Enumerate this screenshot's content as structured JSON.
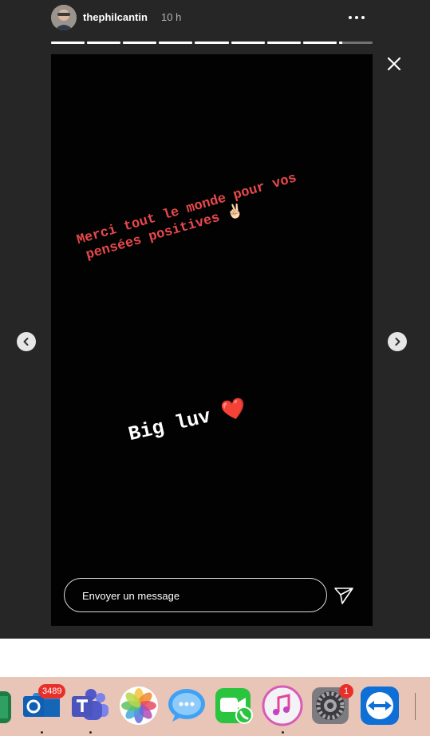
{
  "story": {
    "username": "thephilcantin",
    "time": "10 h",
    "progress_segments": 9,
    "text_line_1": "Merci tout le monde pour vos",
    "text_line_2": "pensées positives ✌🏻",
    "text_big": "Big luv ❤️"
  },
  "reply": {
    "placeholder": "Envoyer un message"
  },
  "icons": {
    "more": "more-options-icon",
    "close": "close-icon",
    "prev": "chevron-left-icon",
    "next": "chevron-right-icon",
    "send": "send-icon"
  },
  "dock": {
    "outlook_badge": "3489",
    "settings_badge": "1"
  },
  "colors": {
    "overlay": "#262626",
    "story_text_red": "#e9484c",
    "badge": "#e8302b",
    "dock": "#e9c5b8"
  }
}
